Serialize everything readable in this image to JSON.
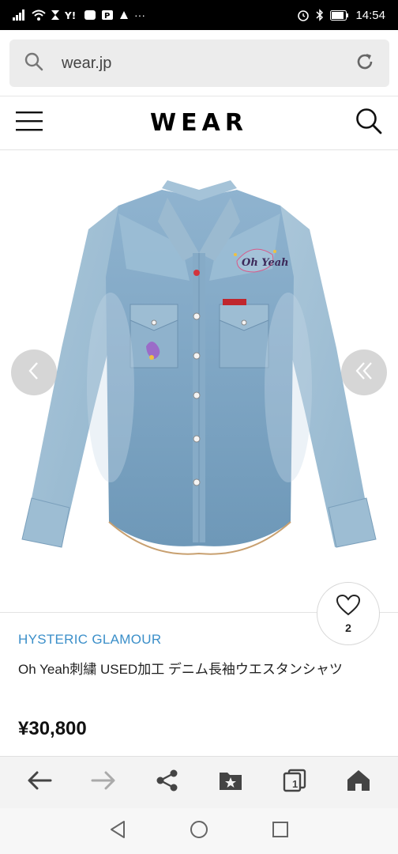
{
  "status_bar": {
    "time": "14:54",
    "more": "···",
    "carrier_icons": [
      "signal-icon",
      "wifi-icon",
      "hourglass-icon",
      "yahoo-icon",
      "app-icon",
      "paypay-icon",
      "notification-icon"
    ],
    "right_icons": [
      "alarm-icon",
      "bluetooth-icon",
      "battery-icon"
    ]
  },
  "browser": {
    "url": "wear.jp"
  },
  "site": {
    "logo": "WEAR"
  },
  "product": {
    "brand": "HYSTERIC GLAMOUR",
    "name": "Oh Yeah刺繍 USED加工 デニム長袖ウエスタンシャツ",
    "price": "¥30,800",
    "favorite_count": "2",
    "embroidery_text": "Oh Yeah"
  },
  "colors": {
    "brand_link": "#3b8fc9",
    "denim_light": "#a9c6da",
    "denim_mid": "#8fb3cd",
    "denim_dark": "#6f97b6"
  }
}
